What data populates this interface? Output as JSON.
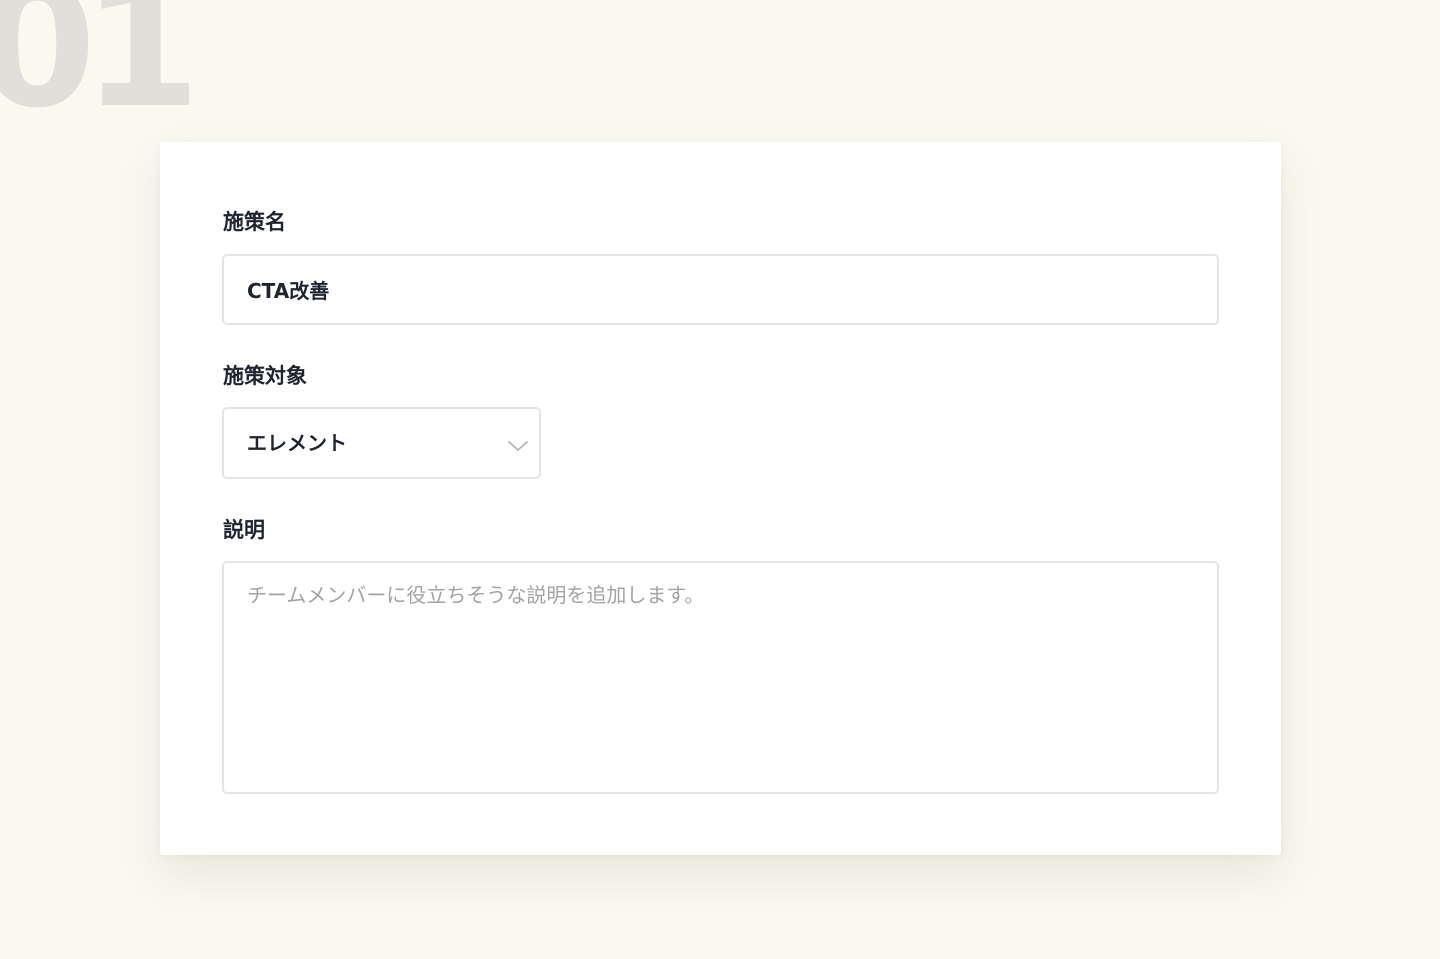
{
  "step": {
    "number": "01"
  },
  "form": {
    "name": {
      "label": "施策名",
      "value": "CTA改善"
    },
    "target": {
      "label": "施策対象",
      "selected": "エレメント",
      "icon": "chevron-down-icon"
    },
    "description": {
      "label": "説明",
      "value": "",
      "placeholder": "チームメンバーに役立ちそうな説明を追加します。"
    }
  },
  "colors": {
    "background": "#f9f9f0",
    "card": "#ffffff",
    "text": "#1f2431",
    "placeholder": "#a3a3a3",
    "border": "#e4e4e4",
    "step_number": "#e0dfd9"
  }
}
